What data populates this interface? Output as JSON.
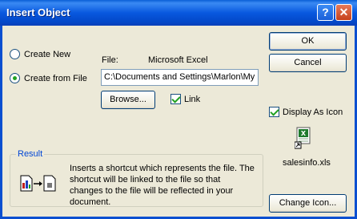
{
  "window": {
    "title": "Insert Object",
    "help_label": "?",
    "close_label": "✕"
  },
  "options": {
    "create_new": "Create New",
    "create_from_file": "Create from File",
    "selected": "create_from_file"
  },
  "file": {
    "label": "File:",
    "type": "Microsoft Excel",
    "path": "C:\\Documents and Settings\\Marlon\\My",
    "browse_label": "Browse...",
    "link_label": "Link",
    "link_checked": true
  },
  "buttons": {
    "ok": "OK",
    "cancel": "Cancel",
    "change_icon": "Change Icon..."
  },
  "display_as_icon": {
    "label": "Display As Icon",
    "checked": true,
    "icon_caption": "salesinfo.xls",
    "icon": "excel-file-icon"
  },
  "result": {
    "legend": "Result",
    "text": "Inserts a shortcut which represents the file.  The shortcut will be linked to the file so that changes to the file will be reflected in your document.",
    "icon": "link-document-icon"
  }
}
